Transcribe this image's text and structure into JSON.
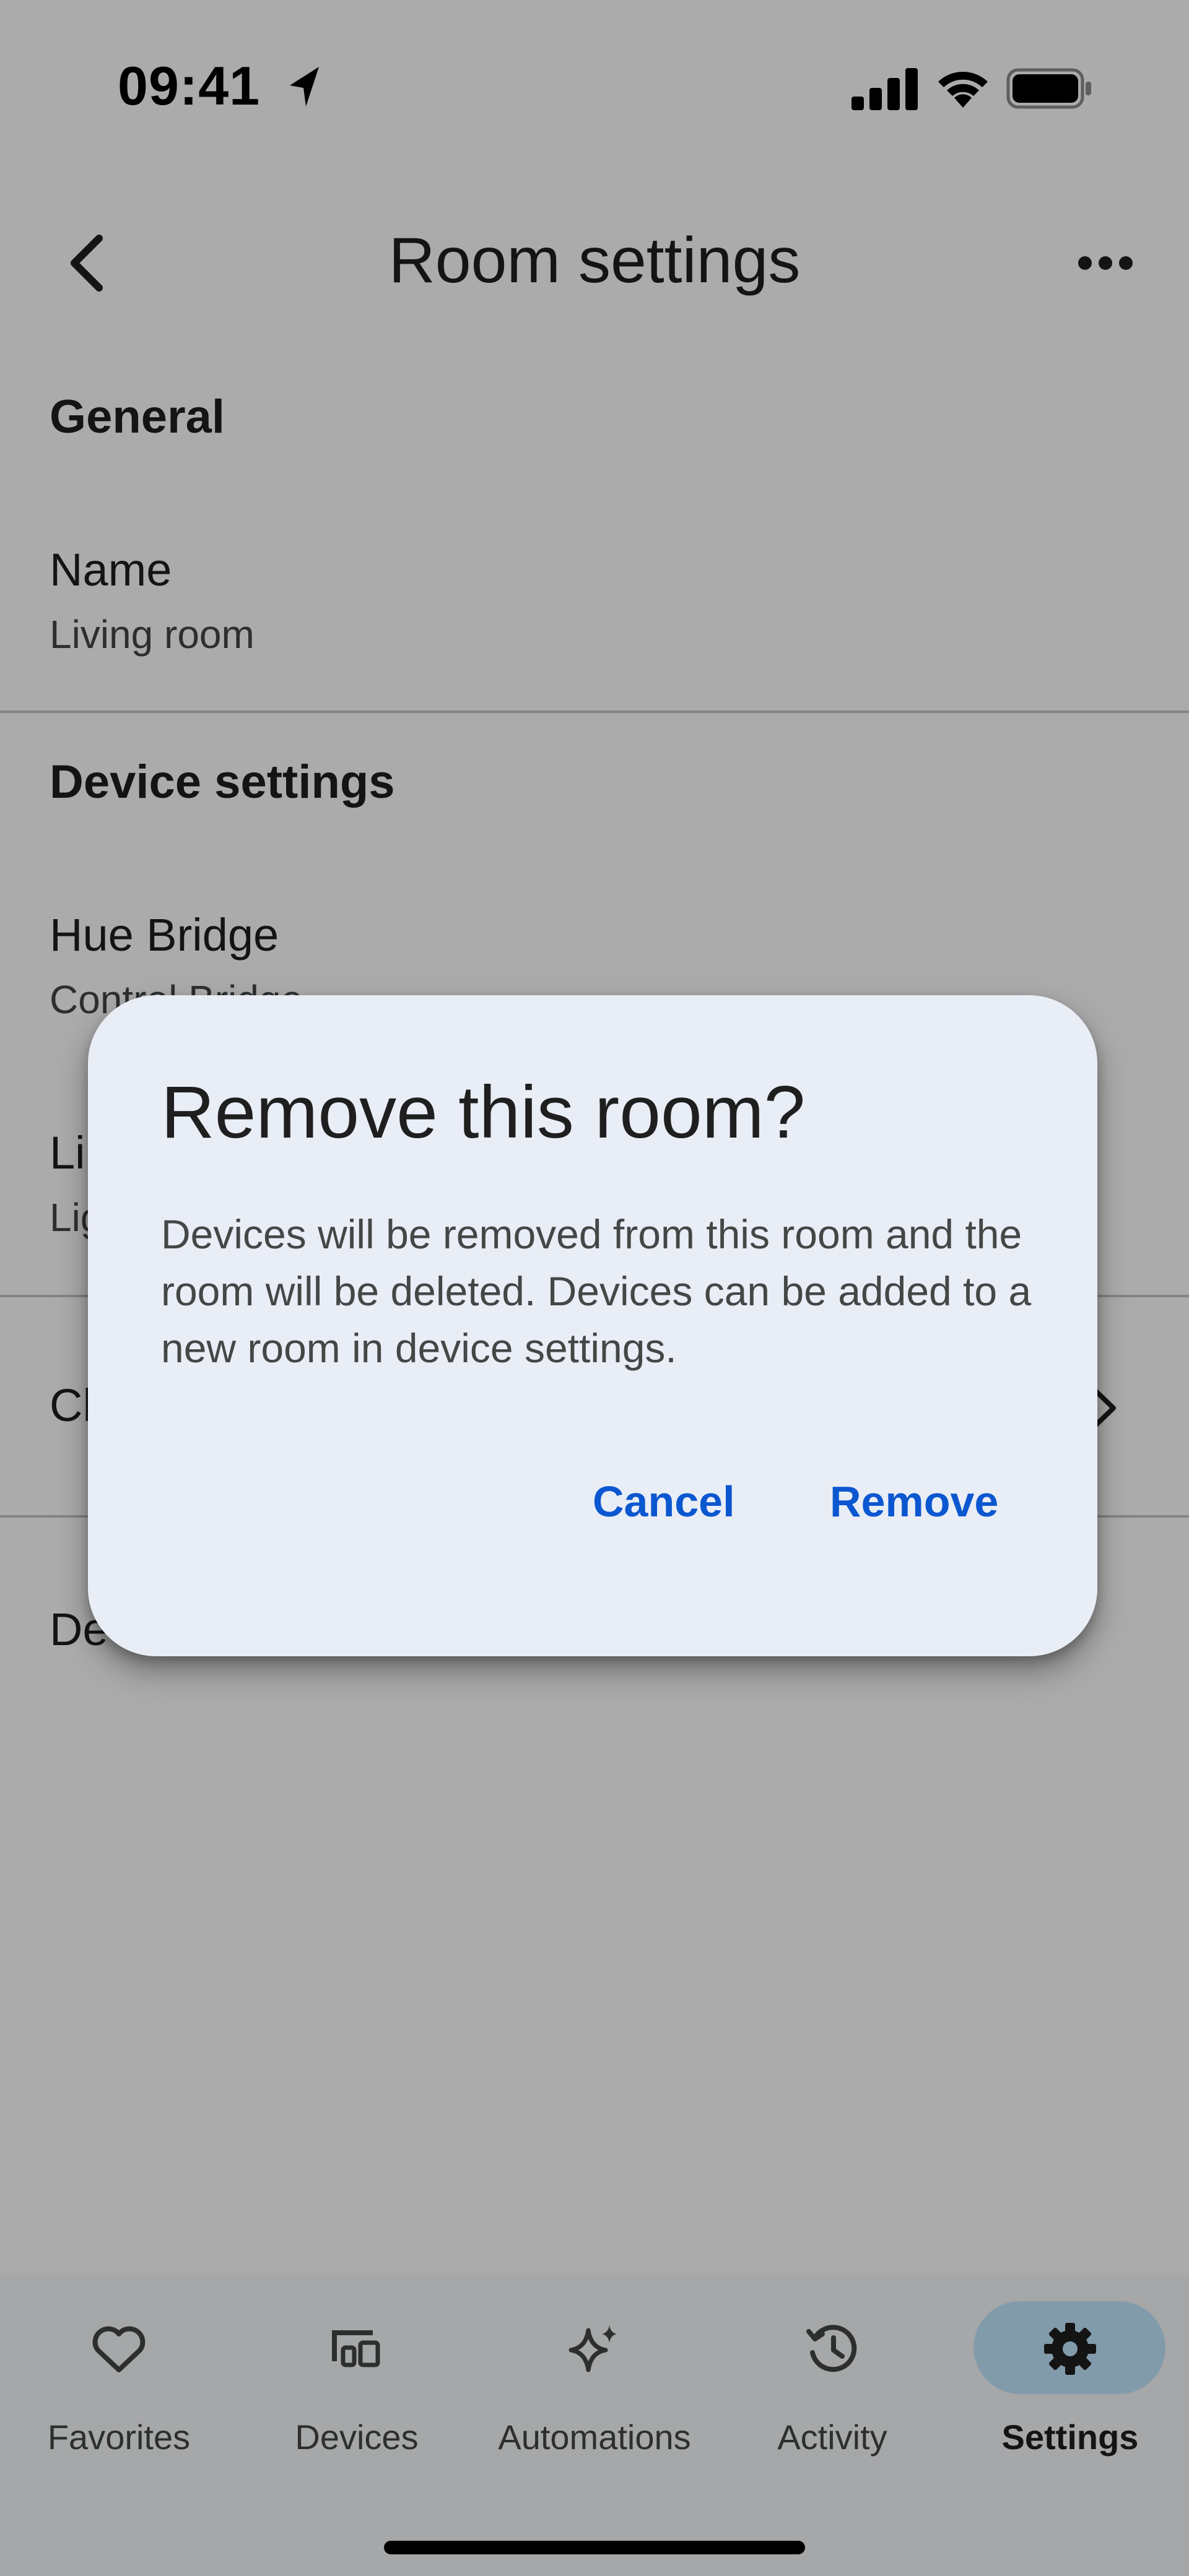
{
  "status_bar": {
    "time": "09:41"
  },
  "header": {
    "title": "Room settings"
  },
  "sections": {
    "general": {
      "header": "General",
      "name_row": {
        "title": "Name",
        "value": "Living room"
      }
    },
    "device_settings": {
      "header": "Device settings",
      "rows": [
        {
          "title": "Hue Bridge",
          "subtitle": "Control Bridge"
        },
        {
          "title": "Li",
          "subtitle": "Lig"
        }
      ]
    },
    "partial_row": {
      "title": "Ch"
    },
    "partial_row_2": {
      "title": "De"
    }
  },
  "dialog": {
    "title": "Remove this room?",
    "body": "Devices will be removed from this room and the room will be deleted. Devices can be added to a new room in device settings.",
    "cancel_label": "Cancel",
    "remove_label": "Remove"
  },
  "bottom_nav": {
    "items": [
      {
        "label": "Favorites",
        "icon": "heart-icon"
      },
      {
        "label": "Devices",
        "icon": "devices-icon"
      },
      {
        "label": "Automations",
        "icon": "sparkle-icon"
      },
      {
        "label": "Activity",
        "icon": "history-icon"
      },
      {
        "label": "Settings",
        "icon": "gear-icon",
        "selected": true
      }
    ]
  },
  "colors": {
    "accent": "#0b57d0",
    "selected_pill": "#c2e7ff",
    "dialog_bg": "#e9edf6"
  }
}
